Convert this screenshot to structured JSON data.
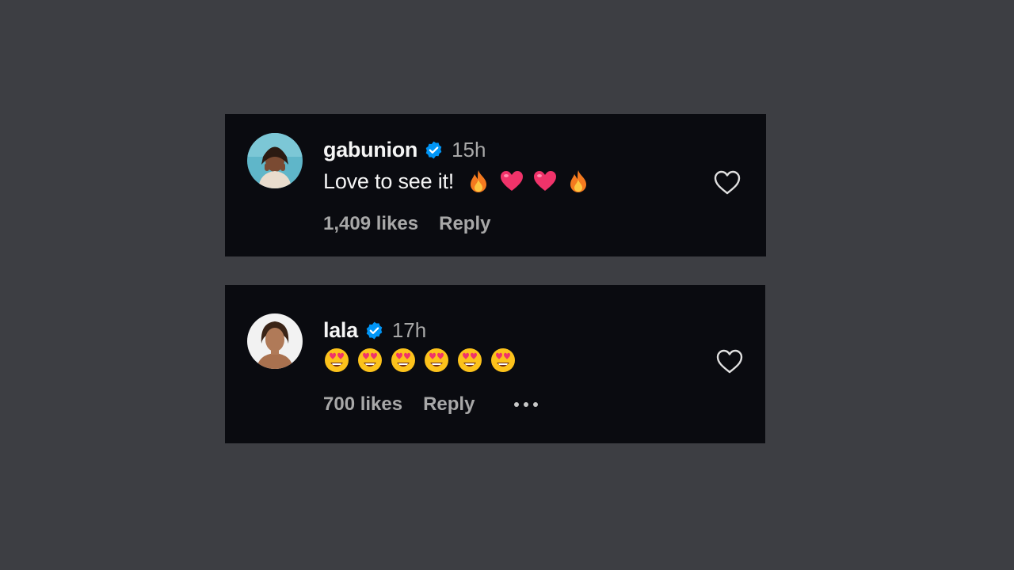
{
  "comments": [
    {
      "username": "gabunion",
      "verified": true,
      "time": "15h",
      "text": "Love to see it!",
      "emojis": [
        "fire-emoji",
        "heart-emoji",
        "heart-emoji",
        "fire-emoji"
      ],
      "likes": "1,409 likes",
      "reply_label": "Reply",
      "like_icon": "heart-outline-icon"
    },
    {
      "username": "lala",
      "verified": true,
      "time": "17h",
      "text": "",
      "emojis": [
        "heart-eyes-emoji",
        "heart-eyes-emoji",
        "heart-eyes-emoji",
        "heart-eyes-emoji",
        "heart-eyes-emoji",
        "heart-eyes-emoji"
      ],
      "likes": "700 likes",
      "reply_label": "Reply",
      "more_icon": "more-options-icon",
      "like_icon": "heart-outline-icon"
    }
  ],
  "colors": {
    "background": "#3d3e43",
    "card": "#0a0b10",
    "text": "#f5f5f5",
    "muted": "#a8a8a8",
    "verified": "#0095f6"
  }
}
